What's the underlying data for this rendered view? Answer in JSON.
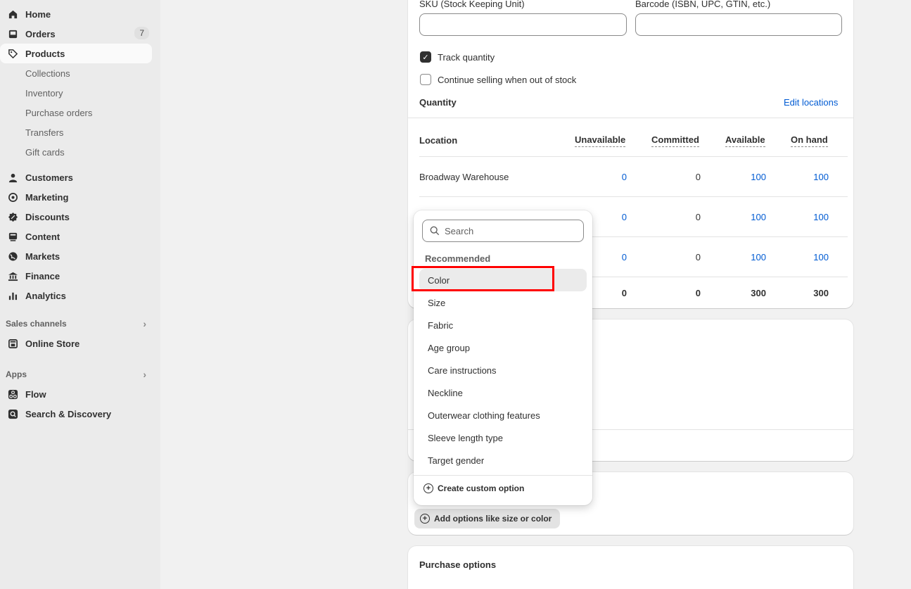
{
  "sidebar": {
    "items": [
      {
        "label": "Home",
        "icon": "home-icon"
      },
      {
        "label": "Orders",
        "icon": "orders-icon",
        "badge": "7"
      },
      {
        "label": "Products",
        "icon": "tag-icon"
      },
      {
        "label": "Customers",
        "icon": "person-icon"
      },
      {
        "label": "Marketing",
        "icon": "target-icon"
      },
      {
        "label": "Discounts",
        "icon": "discount-icon"
      },
      {
        "label": "Content",
        "icon": "content-icon"
      },
      {
        "label": "Markets",
        "icon": "globe-icon"
      },
      {
        "label": "Finance",
        "icon": "bank-icon"
      },
      {
        "label": "Analytics",
        "icon": "bar-chart-icon"
      }
    ],
    "product_sub": [
      "Collections",
      "Inventory",
      "Purchase orders",
      "Transfers",
      "Gift cards"
    ],
    "sales_channels_label": "Sales channels",
    "online_store": "Online Store",
    "apps_label": "Apps",
    "flow": "Flow",
    "search_discovery": "Search & Discovery"
  },
  "inventory": {
    "sku_label": "SKU (Stock Keeping Unit)",
    "barcode_label": "Barcode (ISBN, UPC, GTIN, etc.)",
    "track_quantity": "Track quantity",
    "continue_selling": "Continue selling when out of stock",
    "quantity_heading": "Quantity",
    "edit_locations": "Edit locations",
    "columns": [
      "Location",
      "Unavailable",
      "Committed",
      "Available",
      "On hand"
    ],
    "rows": [
      {
        "location": "Broadway Warehouse",
        "unavailable": "0",
        "committed": "0",
        "available": "100",
        "on_hand": "100"
      },
      {
        "location": "",
        "unavailable": "0",
        "committed": "0",
        "available": "100",
        "on_hand": "100"
      },
      {
        "location": "",
        "unavailable": "0",
        "committed": "0",
        "available": "100",
        "on_hand": "100"
      }
    ],
    "totals": {
      "unavailable": "0",
      "committed": "0",
      "available": "300",
      "on_hand": "300"
    }
  },
  "dropdown": {
    "search_placeholder": "Search",
    "heading": "Recommended",
    "options": [
      "Color",
      "Size",
      "Fabric",
      "Age group",
      "Care instructions",
      "Neckline",
      "Outerwear clothing features",
      "Sleeve length type",
      "Target gender"
    ],
    "create_custom": "Create custom option"
  },
  "variants": {
    "add_options": "Add options like size or color"
  },
  "purchase_options": {
    "heading": "Purchase options"
  }
}
